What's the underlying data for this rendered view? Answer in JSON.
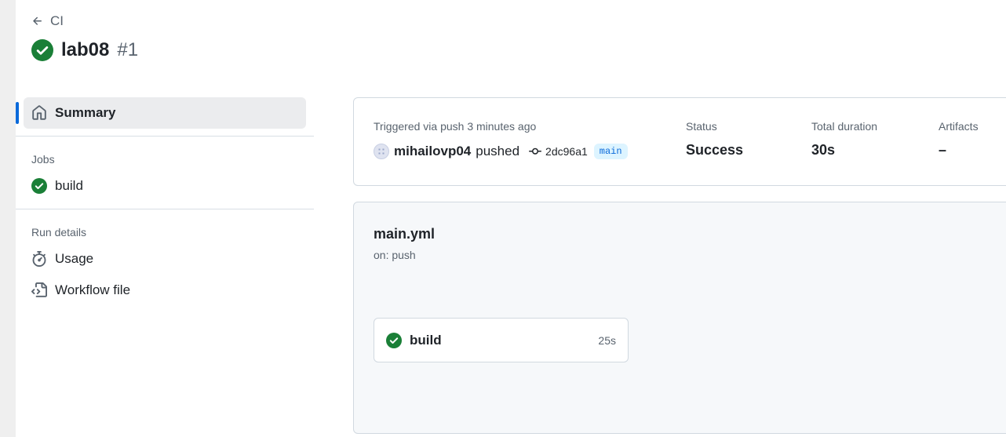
{
  "header": {
    "back_label": "CI",
    "run_name": "lab08",
    "run_number": "#1"
  },
  "sidebar": {
    "summary_label": "Summary",
    "jobs_heading": "Jobs",
    "jobs": [
      {
        "label": "build",
        "status": "success"
      }
    ],
    "run_details_heading": "Run details",
    "details": [
      {
        "label": "Usage",
        "icon": "stopwatch-icon"
      },
      {
        "label": "Workflow file",
        "icon": "file-code-icon"
      }
    ]
  },
  "summary": {
    "trigger_text": "Triggered via push 3 minutes ago",
    "actor": "mihailovp04",
    "verb": "pushed",
    "commit": "2dc96a1",
    "branch": "main",
    "status_label": "Status",
    "status_value": "Success",
    "duration_label": "Total duration",
    "duration_value": "30s",
    "artifacts_label": "Artifacts",
    "artifacts_value": "–"
  },
  "workflow": {
    "file": "main.yml",
    "trigger": "on: push",
    "job": {
      "name": "build",
      "duration": "25s"
    }
  },
  "colors": {
    "success": "#1a7f37",
    "accent": "#0969da"
  }
}
